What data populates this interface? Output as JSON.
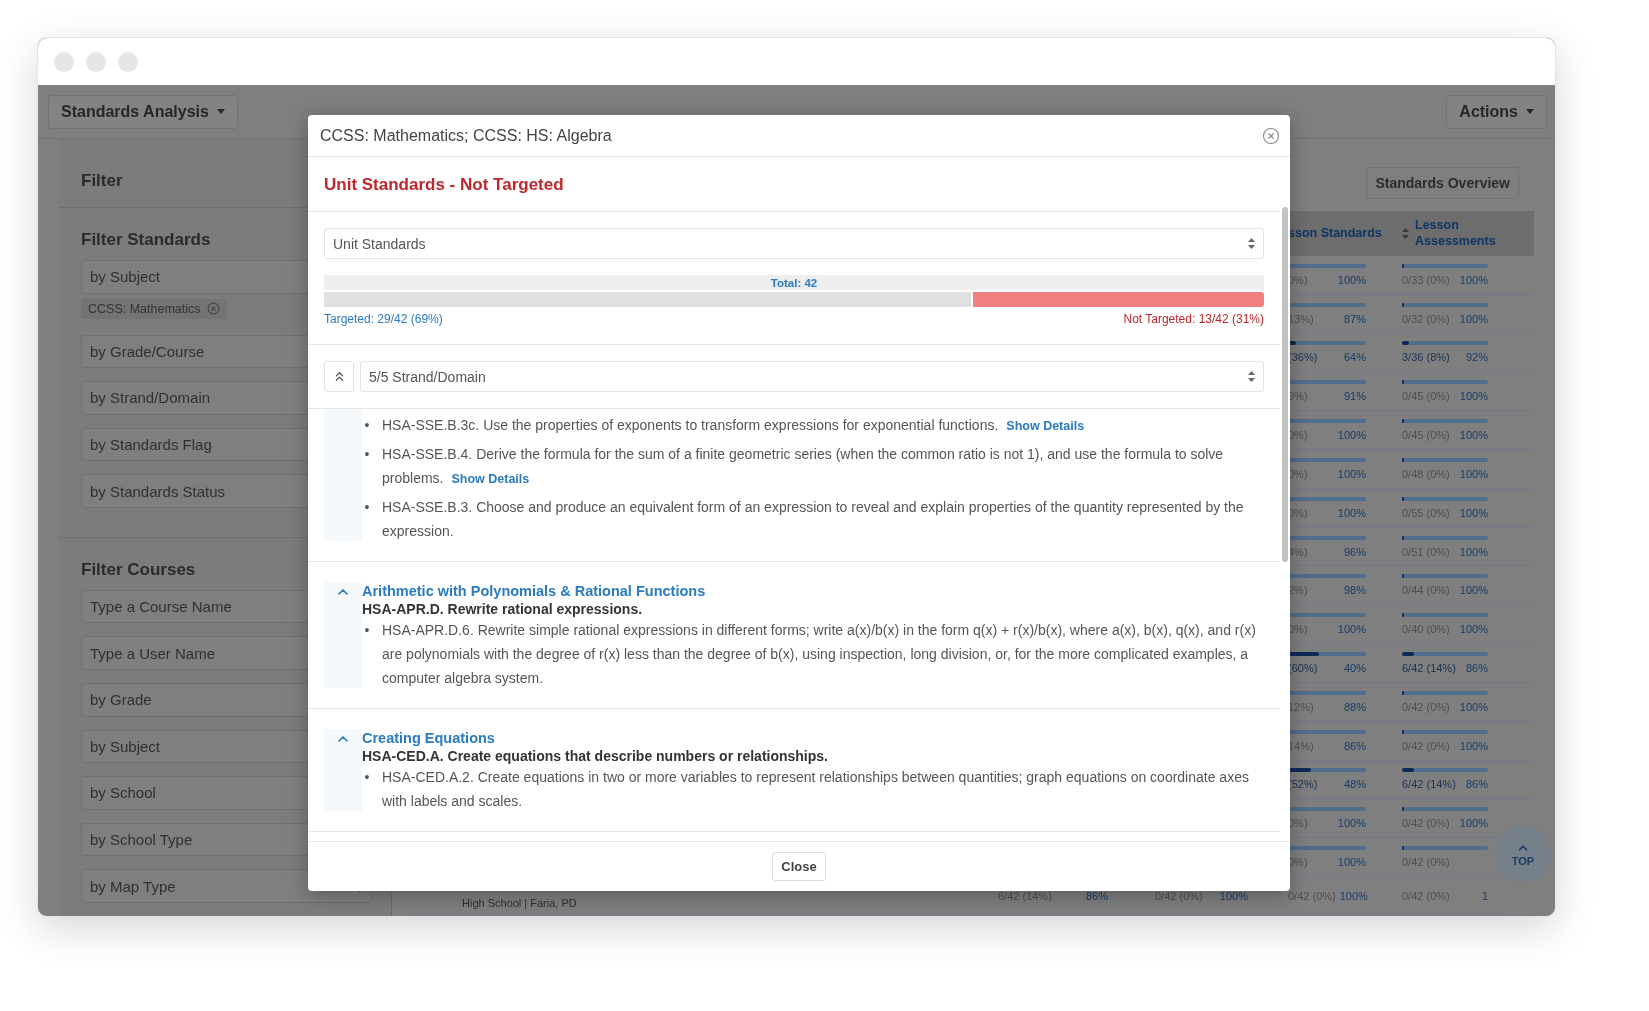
{
  "toolbar": {
    "view_menu": "Standards Analysis",
    "actions_menu": "Actions"
  },
  "sidebar": {
    "title": "Filter",
    "groups": [
      {
        "title": "Filter Standards",
        "fields": [
          {
            "placeholder": "by Subject",
            "kind": "text",
            "tags": [
              "CCSS: Mathematics"
            ]
          },
          {
            "placeholder": "by Grade/Course",
            "kind": "text"
          },
          {
            "placeholder": "by Strand/Domain",
            "kind": "text"
          },
          {
            "placeholder": "by Standards Flag",
            "kind": "text"
          },
          {
            "placeholder": "by Standards Status",
            "kind": "text"
          }
        ]
      },
      {
        "title": "Filter Courses",
        "fields": [
          {
            "placeholder": "Type a Course Name",
            "kind": "text"
          },
          {
            "placeholder": "Type a User Name",
            "kind": "text"
          },
          {
            "placeholder": "by Grade",
            "kind": "text"
          },
          {
            "placeholder": "by Subject",
            "kind": "text"
          },
          {
            "placeholder": "by School",
            "kind": "text"
          },
          {
            "placeholder": "by School Type",
            "kind": "text"
          },
          {
            "placeholder": "by Map Type",
            "kind": "select"
          }
        ]
      }
    ]
  },
  "main": {
    "overview_button": "Standards Overview",
    "top_button": "TOP",
    "table": {
      "columns": [
        {
          "label": "sson Standards",
          "sortable": false
        },
        {
          "label": "Lesson Assessments",
          "sortable": true
        }
      ],
      "rows": [
        {
          "cells": [
            {
              "level": 0,
              "count": "0%)",
              "percent": "100%"
            },
            {
              "level": 0,
              "count": "0/33 (0%)",
              "percent": "100%"
            }
          ]
        },
        {
          "cells": [
            {
              "level": 0,
              "count": "13%)",
              "percent": "87%"
            },
            {
              "level": 0,
              "count": "0/32 (0%)",
              "percent": "100%"
            }
          ]
        },
        {
          "cells": [
            {
              "level": 0.1,
              "count": "(36%)",
              "percent": "64%"
            },
            {
              "level": 0.08,
              "count": "3/36 (8%)",
              "percent": "92%"
            }
          ]
        },
        {
          "cells": [
            {
              "level": 0,
              "count": "9%)",
              "percent": "91%"
            },
            {
              "level": 0,
              "count": "0/45 (0%)",
              "percent": "100%"
            }
          ]
        },
        {
          "cells": [
            {
              "level": 0,
              "count": "0%)",
              "percent": "100%"
            },
            {
              "level": 0,
              "count": "0/45 (0%)",
              "percent": "100%"
            }
          ]
        },
        {
          "cells": [
            {
              "level": 0,
              "count": "0%)",
              "percent": "100%"
            },
            {
              "level": 0,
              "count": "0/48 (0%)",
              "percent": "100%"
            }
          ]
        },
        {
          "cells": [
            {
              "level": 0,
              "count": "0%)",
              "percent": "100%"
            },
            {
              "level": 0,
              "count": "0/55 (0%)",
              "percent": "100%"
            }
          ]
        },
        {
          "cells": [
            {
              "level": 0,
              "count": "4%)",
              "percent": "96%"
            },
            {
              "level": 0,
              "count": "0/51 (0%)",
              "percent": "100%"
            }
          ]
        },
        {
          "cells": [
            {
              "level": 0,
              "count": "2%)",
              "percent": "98%"
            },
            {
              "level": 0,
              "count": "0/44 (0%)",
              "percent": "100%"
            }
          ]
        },
        {
          "cells": [
            {
              "level": 0,
              "count": "0%)",
              "percent": "100%"
            },
            {
              "level": 0,
              "count": "0/40 (0%)",
              "percent": "100%"
            }
          ]
        },
        {
          "cells": [
            {
              "level": 0.4,
              "count": "(60%)",
              "percent": "40%"
            },
            {
              "level": 0.14,
              "count": "6/42 (14%)",
              "percent": "86%"
            }
          ]
        },
        {
          "cells": [
            {
              "level": 0,
              "count": "12%)",
              "percent": "88%"
            },
            {
              "level": 0,
              "count": "0/42 (0%)",
              "percent": "100%"
            }
          ]
        },
        {
          "cells": [
            {
              "level": 0,
              "count": "14%)",
              "percent": "86%"
            },
            {
              "level": 0,
              "count": "0/42 (0%)",
              "percent": "100%"
            }
          ]
        },
        {
          "cells": [
            {
              "level": 0.3,
              "count": "(52%)",
              "percent": "48%"
            },
            {
              "level": 0.14,
              "count": "6/42 (14%)",
              "percent": "86%"
            }
          ]
        },
        {
          "cells": [
            {
              "level": 0,
              "count": "0%)",
              "percent": "100%"
            },
            {
              "level": 0,
              "count": "0/42 (0%)",
              "percent": "100%"
            }
          ]
        },
        {
          "cells": [
            {
              "level": 0,
              "count": "0%)",
              "percent": "100%"
            },
            {
              "level": 0,
              "count": "0/42 (0%)"
            }
          ]
        },
        {
          "course": "High School | Faria, PD",
          "cells": [
            {
              "count": "6/42 (14%)",
              "percent": "86%"
            },
            {
              "count": "0/42 (0%)",
              "percent": "100%"
            },
            {
              "count": "0/42 (0%)",
              "percent": "100%"
            },
            {
              "count": "0/42 (0%)",
              "percent": "1"
            }
          ]
        }
      ]
    }
  },
  "modal": {
    "title": "CCSS: Mathematics; CCSS: HS: Algebra",
    "heading": "Unit Standards - Not Targeted",
    "view_select": {
      "value": "Unit Standards"
    },
    "progress": {
      "total": "Total: 42",
      "level": 0.69,
      "targeted": "Targeted: 29/42 (69%)",
      "not_targeted": "Not Targeted: 13/42 (31%)"
    },
    "strand_select": {
      "value": "5/5 Strand/Domain"
    },
    "sections": [
      {
        "standards": [
          {
            "bullet": "•",
            "text": "HSA-SSE.B.3c. Use the properties of exponents to transform expressions for exponential functions.",
            "link": "Show Details"
          },
          {
            "bullet": "•",
            "text": "HSA-SSE.B.4. Derive the formula for the sum of a finite geometric series (when the common ratio is not 1), and use the formula to solve problems.",
            "link": "Show Details"
          },
          {
            "bullet": "•",
            "text": "HSA-SSE.B.3. Choose and produce an equivalent form of an expression to reveal and explain properties of the quantity represented by the expression."
          }
        ]
      },
      {
        "title": "Arithmetic with Polynomials & Rational Functions",
        "subtitle": "HSA-APR.D. Rewrite rational expressions.",
        "expanded": true,
        "standards": [
          {
            "bullet": "•",
            "text": "HSA-APR.D.6. Rewrite simple rational expressions in different forms; write a(x)/b(x) in the form q(x) + r(x)/b(x), where a(x), b(x), q(x), and r(x) are polynomials with the degree of r(x) less than the degree of b(x), using inspection, long division, or, for the more complicated examples, a computer algebra system."
          }
        ]
      },
      {
        "title": "Creating Equations",
        "subtitle": "HSA-CED.A. Create equations that describe numbers or relationships.",
        "expanded": true,
        "standards": [
          {
            "bullet": "•",
            "text": "HSA-CED.A.2. Create equations in two or more variables to represent relationships between quantities; graph equations on coordinate axes with labels and scales."
          }
        ]
      }
    ],
    "close_button": "Close"
  }
}
